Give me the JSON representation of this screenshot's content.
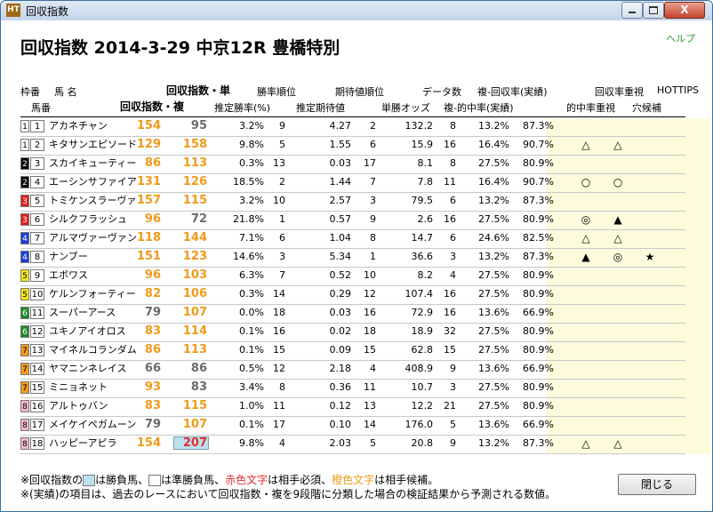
{
  "window": {
    "title": "回収指数",
    "close_glyph": "X",
    "app_icon_text": "HT"
  },
  "help_label": "ヘルプ",
  "heading": "回収指数  2014-3-29 中京12R 豊橋特別",
  "headers": {
    "row1": {
      "waku_label": "枠番",
      "name_label": "馬 名",
      "tan_index": "回収指数・単",
      "prob_rank": "勝率順位",
      "exp_rank": "期待値順位",
      "data_count": "データ数",
      "place_return": "複-回収率(実績)",
      "return_focus": "回収率重視",
      "hottips": "HOTTIPS"
    },
    "row2": {
      "uma_label": "馬番",
      "fuku_index": "回収指数・複",
      "est_win_rate": "推定勝率(%)",
      "est_exp": "推定期待値",
      "win_odds": "単勝オッズ",
      "place_hit": "複-的中率(実績)",
      "hit_focus": "的中率重視",
      "dark_horse": "穴候補"
    }
  },
  "rows": [
    {
      "waku": "1",
      "waku_bg": "#ffffff",
      "waku_fg": "#000000",
      "uma": "1",
      "name": "アカネチャン",
      "tan": "154",
      "tan_color": "orange",
      "fuku": "95",
      "fuku_color": "gray",
      "fuku_box": false,
      "prob": "3.2%",
      "prob_rank": "9",
      "exp": "4.27",
      "exp_rank": "2",
      "odds": "132.2",
      "count": "8",
      "hit": "13.2%",
      "rate": "87.3%",
      "m1": "",
      "m2": "",
      "m3": ""
    },
    {
      "waku": "1",
      "waku_bg": "#ffffff",
      "waku_fg": "#000000",
      "uma": "2",
      "name": "キタサンエピソード",
      "tan": "129",
      "tan_color": "orange",
      "fuku": "158",
      "fuku_color": "orange",
      "fuku_box": false,
      "prob": "9.8%",
      "prob_rank": "5",
      "exp": "1.55",
      "exp_rank": "6",
      "odds": "15.9",
      "count": "16",
      "hit": "16.4%",
      "rate": "90.7%",
      "m1": "△",
      "m2": "△",
      "m3": ""
    },
    {
      "waku": "2",
      "waku_bg": "#000000",
      "waku_fg": "#ffffff",
      "uma": "3",
      "name": "スカイキューティー",
      "tan": "86",
      "tan_color": "orange",
      "fuku": "113",
      "fuku_color": "orange",
      "fuku_box": false,
      "prob": "0.3%",
      "prob_rank": "13",
      "exp": "0.03",
      "exp_rank": "17",
      "odds": "8.1",
      "count": "8",
      "hit": "27.5%",
      "rate": "80.9%",
      "m1": "",
      "m2": "",
      "m3": ""
    },
    {
      "waku": "2",
      "waku_bg": "#000000",
      "waku_fg": "#ffffff",
      "uma": "4",
      "name": "エーシンサファイア",
      "tan": "131",
      "tan_color": "orange",
      "fuku": "126",
      "fuku_color": "orange",
      "fuku_box": false,
      "prob": "18.5%",
      "prob_rank": "2",
      "exp": "1.44",
      "exp_rank": "7",
      "odds": "7.8",
      "count": "11",
      "hit": "16.4%",
      "rate": "90.7%",
      "m1": "○",
      "m2": "○",
      "m3": ""
    },
    {
      "waku": "3",
      "waku_bg": "#e02020",
      "waku_fg": "#ffffff",
      "uma": "5",
      "name": "トミケンスラーヴァ",
      "tan": "157",
      "tan_color": "orange",
      "fuku": "115",
      "fuku_color": "orange",
      "fuku_box": false,
      "prob": "3.2%",
      "prob_rank": "10",
      "exp": "2.57",
      "exp_rank": "3",
      "odds": "79.5",
      "count": "6",
      "hit": "13.2%",
      "rate": "87.3%",
      "m1": "",
      "m2": "",
      "m3": ""
    },
    {
      "waku": "3",
      "waku_bg": "#e02020",
      "waku_fg": "#ffffff",
      "uma": "6",
      "name": "シルクフラッシュ",
      "tan": "96",
      "tan_color": "orange",
      "fuku": "72",
      "fuku_color": "gray",
      "fuku_box": false,
      "prob": "21.8%",
      "prob_rank": "1",
      "exp": "0.57",
      "exp_rank": "9",
      "odds": "2.6",
      "count": "16",
      "hit": "27.5%",
      "rate": "80.9%",
      "m1": "◎",
      "m2": "▲",
      "m3": ""
    },
    {
      "waku": "4",
      "waku_bg": "#1a3fd8",
      "waku_fg": "#ffffff",
      "uma": "7",
      "name": "アルマヴァーヴァン",
      "tan": "118",
      "tan_color": "orange",
      "fuku": "144",
      "fuku_color": "orange",
      "fuku_box": false,
      "prob": "7.1%",
      "prob_rank": "6",
      "exp": "1.04",
      "exp_rank": "8",
      "odds": "14.7",
      "count": "6",
      "hit": "24.6%",
      "rate": "82.5%",
      "m1": "△",
      "m2": "△",
      "m3": ""
    },
    {
      "waku": "4",
      "waku_bg": "#1a3fd8",
      "waku_fg": "#ffffff",
      "uma": "8",
      "name": "ナンブー",
      "tan": "151",
      "tan_color": "orange",
      "fuku": "123",
      "fuku_color": "orange",
      "fuku_box": false,
      "prob": "14.6%",
      "prob_rank": "3",
      "exp": "5.34",
      "exp_rank": "1",
      "odds": "36.6",
      "count": "3",
      "hit": "13.2%",
      "rate": "87.3%",
      "m1": "▲",
      "m2": "◎",
      "m3": "★"
    },
    {
      "waku": "5",
      "waku_bg": "#f5e61a",
      "waku_fg": "#000000",
      "uma": "9",
      "name": "エボワス",
      "tan": "96",
      "tan_color": "orange",
      "fuku": "103",
      "fuku_color": "orange",
      "fuku_box": false,
      "prob": "6.3%",
      "prob_rank": "7",
      "exp": "0.52",
      "exp_rank": "10",
      "odds": "8.2",
      "count": "4",
      "hit": "27.5%",
      "rate": "80.9%",
      "m1": "",
      "m2": "",
      "m3": ""
    },
    {
      "waku": "5",
      "waku_bg": "#f5e61a",
      "waku_fg": "#000000",
      "uma": "10",
      "name": "ケルンフォーティー",
      "tan": "82",
      "tan_color": "orange",
      "fuku": "106",
      "fuku_color": "orange",
      "fuku_box": false,
      "prob": "0.3%",
      "prob_rank": "14",
      "exp": "0.29",
      "exp_rank": "12",
      "odds": "107.4",
      "count": "16",
      "hit": "27.5%",
      "rate": "80.9%",
      "m1": "",
      "m2": "",
      "m3": ""
    },
    {
      "waku": "6",
      "waku_bg": "#1f8a2a",
      "waku_fg": "#ffffff",
      "uma": "11",
      "name": "スーパーアース",
      "tan": "79",
      "tan_color": "gray",
      "fuku": "107",
      "fuku_color": "orange",
      "fuku_box": false,
      "prob": "0.0%",
      "prob_rank": "18",
      "exp": "0.03",
      "exp_rank": "16",
      "odds": "72.9",
      "count": "16",
      "hit": "13.6%",
      "rate": "66.9%",
      "m1": "",
      "m2": "",
      "m3": ""
    },
    {
      "waku": "6",
      "waku_bg": "#1f8a2a",
      "waku_fg": "#ffffff",
      "uma": "12",
      "name": "ユキノアイオロス",
      "tan": "83",
      "tan_color": "orange",
      "fuku": "114",
      "fuku_color": "orange",
      "fuku_box": false,
      "prob": "0.1%",
      "prob_rank": "16",
      "exp": "0.02",
      "exp_rank": "18",
      "odds": "18.9",
      "count": "32",
      "hit": "27.5%",
      "rate": "80.9%",
      "m1": "",
      "m2": "",
      "m3": ""
    },
    {
      "waku": "7",
      "waku_bg": "#f29a1c",
      "waku_fg": "#000000",
      "uma": "13",
      "name": "マイネルコランダム",
      "tan": "86",
      "tan_color": "orange",
      "fuku": "113",
      "fuku_color": "orange",
      "fuku_box": false,
      "prob": "0.1%",
      "prob_rank": "15",
      "exp": "0.09",
      "exp_rank": "15",
      "odds": "62.8",
      "count": "15",
      "hit": "27.5%",
      "rate": "80.9%",
      "m1": "",
      "m2": "",
      "m3": ""
    },
    {
      "waku": "7",
      "waku_bg": "#f29a1c",
      "waku_fg": "#000000",
      "uma": "14",
      "name": "ヤマニンネレイス",
      "tan": "66",
      "tan_color": "gray",
      "fuku": "86",
      "fuku_color": "gray",
      "fuku_box": false,
      "prob": "0.5%",
      "prob_rank": "12",
      "exp": "2.18",
      "exp_rank": "4",
      "odds": "408.9",
      "count": "9",
      "hit": "13.6%",
      "rate": "66.9%",
      "m1": "",
      "m2": "",
      "m3": ""
    },
    {
      "waku": "7",
      "waku_bg": "#f29a1c",
      "waku_fg": "#000000",
      "uma": "15",
      "name": "ミニョネット",
      "tan": "93",
      "tan_color": "orange",
      "fuku": "83",
      "fuku_color": "gray",
      "fuku_box": false,
      "prob": "3.4%",
      "prob_rank": "8",
      "exp": "0.36",
      "exp_rank": "11",
      "odds": "10.7",
      "count": "3",
      "hit": "27.5%",
      "rate": "80.9%",
      "m1": "",
      "m2": "",
      "m3": ""
    },
    {
      "waku": "8",
      "waku_bg": "#f5b8c8",
      "waku_fg": "#000000",
      "uma": "16",
      "name": "アルトゥバン",
      "tan": "83",
      "tan_color": "orange",
      "fuku": "115",
      "fuku_color": "orange",
      "fuku_box": false,
      "prob": "1.0%",
      "prob_rank": "11",
      "exp": "0.12",
      "exp_rank": "13",
      "odds": "12.2",
      "count": "21",
      "hit": "27.5%",
      "rate": "80.9%",
      "m1": "",
      "m2": "",
      "m3": ""
    },
    {
      "waku": "8",
      "waku_bg": "#f5b8c8",
      "waku_fg": "#000000",
      "uma": "17",
      "name": "メイケイペガムーン",
      "tan": "79",
      "tan_color": "gray",
      "fuku": "107",
      "fuku_color": "orange",
      "fuku_box": false,
      "prob": "0.1%",
      "prob_rank": "17",
      "exp": "0.10",
      "exp_rank": "14",
      "odds": "176.0",
      "count": "5",
      "hit": "13.6%",
      "rate": "66.9%",
      "m1": "",
      "m2": "",
      "m3": ""
    },
    {
      "waku": "8",
      "waku_bg": "#f5b8c8",
      "waku_fg": "#000000",
      "uma": "18",
      "name": "ハッピーアピラ",
      "tan": "154",
      "tan_color": "orange",
      "fuku": "207",
      "fuku_color": "red",
      "fuku_box": true,
      "prob": "9.8%",
      "prob_rank": "4",
      "exp": "2.03",
      "exp_rank": "5",
      "odds": "20.8",
      "count": "9",
      "hit": "13.2%",
      "rate": "87.3%",
      "m1": "△",
      "m2": "△",
      "m3": ""
    }
  ],
  "footer": {
    "line1_a": "※回収指数の",
    "line1_b": "は勝負馬、",
    "line1_c": "は準勝負馬、",
    "line1_d": "赤色文字",
    "line1_e": "は相手必須、",
    "line1_f": "橙色文字",
    "line1_g": "は相手候補。",
    "line2": "※(実績)の項目は、過去のレースにおいて回収指数・複を9段階に分類した場合の検証結果から予測される数値。"
  },
  "close_button": "閉じる",
  "colors": {
    "orange": "#f09a19",
    "gray": "#6a6a6a",
    "red": "#e33030",
    "highlight_bg": "#fdfbdc",
    "title_accent": "#2e9a2e"
  }
}
